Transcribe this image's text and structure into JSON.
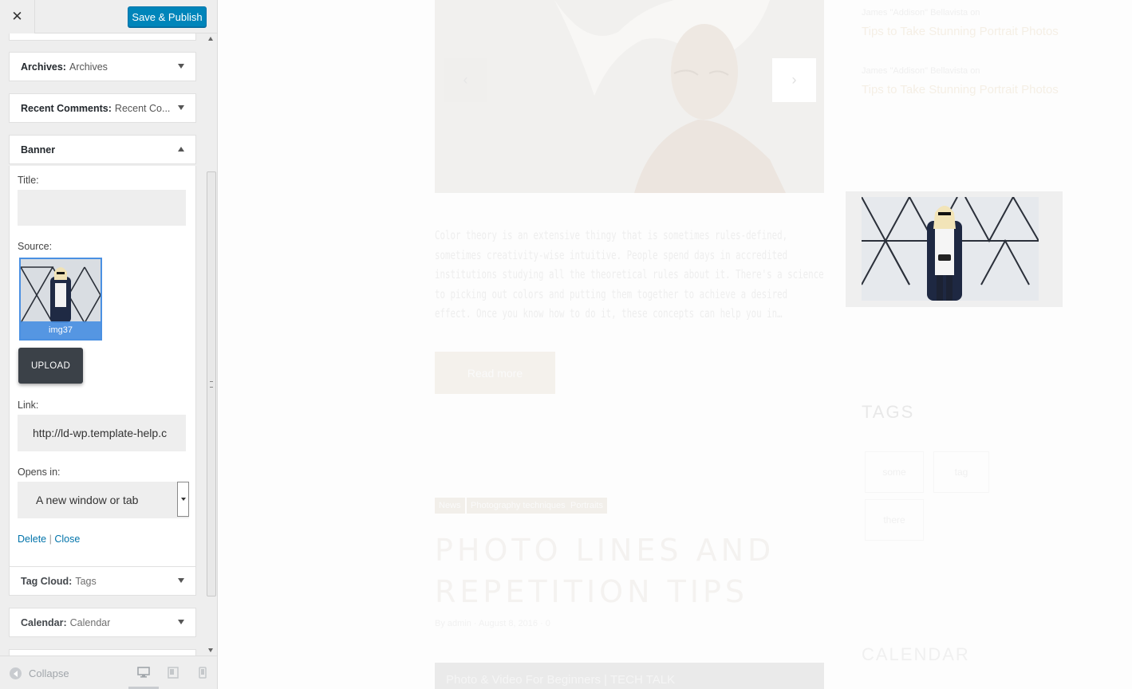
{
  "topbar": {
    "close_glyph": "✕",
    "publish_label": "Save & Publish"
  },
  "widgets": {
    "archives": {
      "title": "Archives:",
      "value": "Archives"
    },
    "recent_comments": {
      "title": "Recent Comments:",
      "value": "Recent Co..."
    },
    "banner": {
      "title": "Banner",
      "title_label": "Title:",
      "title_value": "",
      "source_label": "Source:",
      "source_file": "img37",
      "upload_label": "UPLOAD",
      "link_label": "Link:",
      "link_value": "http://ld-wp.template-help.c",
      "opens_label": "Opens in:",
      "opens_value": "A new window or tab",
      "delete_label": "Delete",
      "separator": "|",
      "close_label": "Close"
    },
    "tag_cloud": {
      "title": "Tag Cloud:",
      "value": "Tags"
    },
    "calendar": {
      "title": "Calendar:",
      "value": "Calendar"
    }
  },
  "footer": {
    "collapse_label": "Collapse"
  },
  "preview": {
    "comments": [
      {
        "author": "James \"Addison\" Bellavista on",
        "link": "Tips to Take Stunning Portrait Photos"
      },
      {
        "author": "James \"Addison\" Bellavista on",
        "link": "Tips to Take Stunning Portrait Photos"
      }
    ],
    "excerpt": "Color theory is an extensive thingy that is sometimes rules-defined, sometimes creativity-wise intuitive. People spend days in accredited institutions studying all the theoretical rules about it. There's a science to picking out colors and putting them together to achieve a desired effect. Once you know how to do it, these concepts can help you in…",
    "read_more": "Read more",
    "categories": [
      "News",
      "Photography techniques",
      "Portraits"
    ],
    "post_title": "PHOTO LINES AND REPETITION TIPS",
    "post_meta": "By admin · August 8, 2016 · 0",
    "video_title": "Photo & Video For Beginners | TECH TALK",
    "tags_heading": "TAGS",
    "tags": [
      "some",
      "tag",
      "there"
    ],
    "calendar_heading": "CALENDAR"
  }
}
